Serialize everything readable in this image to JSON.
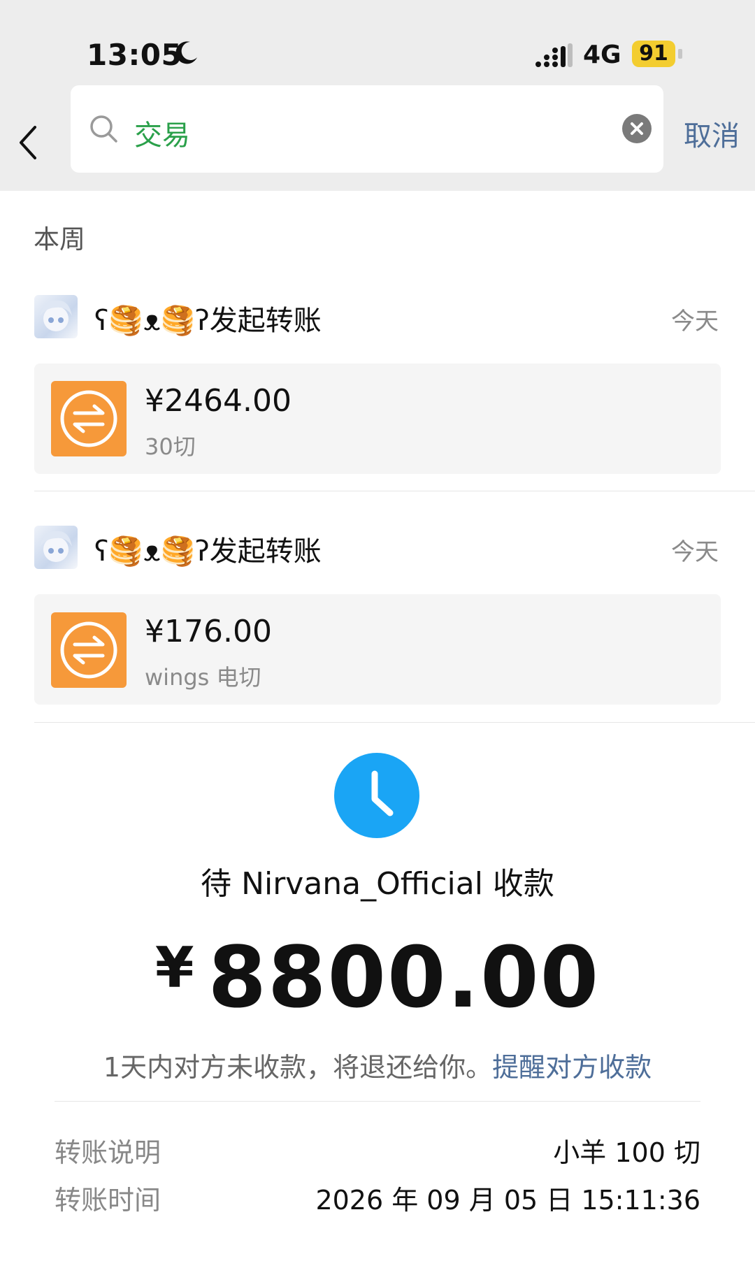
{
  "status_bar": {
    "time": "13:05",
    "network": "4G",
    "battery": "91"
  },
  "search": {
    "query": "交易",
    "cancel_label": "取消"
  },
  "section": {
    "title": "本周"
  },
  "transactions": [
    {
      "sender_line": "ʕ🥞ᴥ🥞ʔ发起转账",
      "date": "今天",
      "amount": "¥2464.00",
      "note": "30切"
    },
    {
      "sender_line": "ʕ🥞ᴥ🥞ʔ发起转账",
      "date": "今天",
      "amount": "¥176.00",
      "note": "wings 电切"
    }
  ],
  "pending": {
    "status_text": "待 Nirvana_Official 收款",
    "currency": "¥",
    "amount": "8800.00",
    "refund_text": "1天内对方未收款，将退还给你。",
    "remind_link": "提醒对方收款"
  },
  "details": [
    {
      "label": "转账说明",
      "value": "小羊 100 切"
    },
    {
      "label": "转账时间",
      "value": "2026 年 09 月 05 日 15:11:36"
    }
  ],
  "colors": {
    "header_bg": "#ededed",
    "search_text": "#2aa04a",
    "link": "#4e6e99",
    "transfer_icon": "#f6993a",
    "clock_icon": "#1aa5f5",
    "battery": "#f3cd30"
  }
}
